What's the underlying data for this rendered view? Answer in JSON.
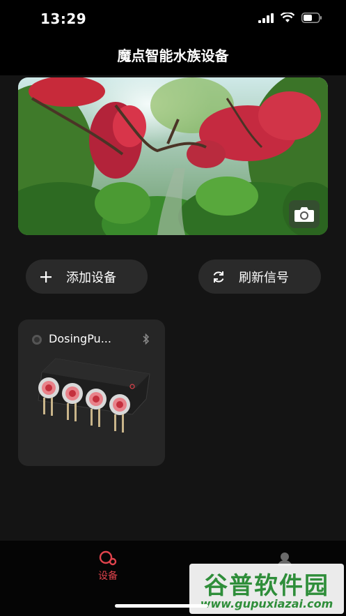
{
  "status_bar": {
    "time": "13:29"
  },
  "nav": {
    "title": "魔点智能水族设备"
  },
  "hero": {
    "image": "aquascape-photo",
    "camera_icon": "camera-icon"
  },
  "actions": {
    "add_label": "添加设备",
    "refresh_label": "刷新信号"
  },
  "devices": [
    {
      "name": "DosingPu...",
      "connection_icon": "bluetooth-icon",
      "image": "dosing-pump-4-head"
    }
  ],
  "tab_bar": {
    "active_color": "#e0434c",
    "tabs": [
      {
        "label": "设备",
        "icon": "device-tab-icon",
        "active": true
      },
      {
        "label": "",
        "icon": "user-tab-icon",
        "active": false
      }
    ]
  },
  "watermark": {
    "title": "谷普软件园",
    "url": "www.gupuxiazai.com"
  }
}
